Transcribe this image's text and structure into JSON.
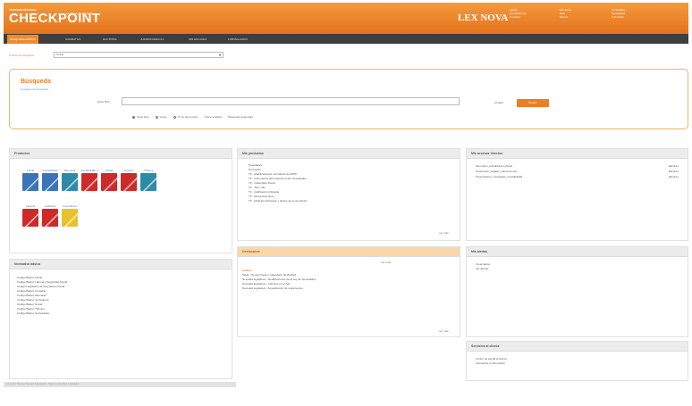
{
  "header": {
    "brand_small": "THOMSON REUTERS",
    "brand": "CHECKPOINT",
    "brand_sub": "Lex Nova Atualizações",
    "lexnova": "LEX NOVA",
    "links_col1": [
      "Ayuda",
      "Herramientas",
      "Contacto"
    ],
    "links_col2": [
      "Mis datos",
      "Salir",
      "Idioma"
    ],
    "links_col3": [
      "Comunidad",
      "Novedades",
      "Formación"
    ]
  },
  "nav": {
    "tabs": [
      "BÚSQUEDA RÁPIDA",
      "NORMATIVA",
      "DOCTRINA",
      "JURISPRUDENCIA",
      "MIS ENLACES",
      "FORMULARIOS"
    ]
  },
  "scope": {
    "label": "Ámbito de búsqueda:",
    "value": "Todos",
    "arrow": "▼"
  },
  "search": {
    "title": "Búsqueda",
    "subtitle": "Consejos de búsqueda",
    "label": "Texto libre",
    "clear": "Limpiar",
    "button": "Buscar",
    "options": [
      "Texto libre",
      "Voces",
      "Nº de documento",
      "Índice analítico",
      "Búsqueda avanzada"
    ]
  },
  "productos": {
    "title": "Productos",
    "row1": [
      {
        "label": "Fiscal",
        "color": "#3a74b8"
      },
      {
        "label": "Contabilidad",
        "color": "#3a74b8"
      },
      {
        "label": "Mercantil",
        "color": "#2e8aa8"
      },
      {
        "label": "Contabilidad II",
        "color": "#cf2a2a"
      },
      {
        "label": "Social",
        "color": "#cf2a2a"
      },
      {
        "label": "Seguros",
        "color": "#cf2a2a"
      },
      {
        "label": "Tributos",
        "color": "#2e8aa8"
      }
    ],
    "row2": [
      {
        "label": "Laboral",
        "color": "#cf2a2a"
      },
      {
        "label": "Auditoría",
        "color": "#cf2a2a"
      },
      {
        "label": "Formularios",
        "color": "#e8c22a"
      }
    ]
  },
  "novedades": {
    "title": "Mis productos",
    "items": [
      "Novedades",
      "Normativa",
      "TF - Modificaciones normativas del IRPF",
      "TF - Información del impuesto sobre Sociedades",
      "TF - Calendario Fiscal",
      "TF - Tipo más",
      "TF - Calificación tributaria",
      "TF - Resolución tipos",
      "TF - Modelos tributarios y plazos de presentación"
    ],
    "more": "ver más"
  },
  "accesos": {
    "title": "Mis accesos directos",
    "items": [
      {
        "label": "Seminario_actualizacion_fiscal",
        "action": "Eliminar"
      },
      {
        "label": "Producción_análisis_subvenciones",
        "action": "Eliminar"
      },
      {
        "label": "Presentación_novedades_Contabilidad",
        "action": "Eliminar"
      }
    ]
  },
  "destacados": {
    "title": "Destacados",
    "top_link": "Ver todo",
    "intro": "Análisis",
    "items": [
      "Tabla - Tiempo fiscal y Calendario 2015-2016",
      "Novedad legislativa - Modificaciones de la Ley de Sociedades",
      "Novedad legislativa - Cambios en el IVA",
      "Novedad legislativa - Actualización de reglamentos"
    ],
    "more": "ver más"
  },
  "misaltas": {
    "title": "Mis alertas",
    "items": [
      "Crear alerta",
      "Ver alertas"
    ]
  },
  "normativa": {
    "title": "Normativa básica",
    "items": [
      "Código Básico Fiscal",
      "Código Básico Laboral y Seguridad Social",
      "Código Legislativo de Regulación Fiscal",
      "Código Básico Contable",
      "Código Básico Mercantil",
      "Código Básico de Seguros",
      "Código Básico Social",
      "Código Básico Tributos",
      "Código Básico Sociedades"
    ]
  },
  "servicios": {
    "title": "Servicios al cliente",
    "items": [
      "Centro de ayuda al cliente",
      "Formación e información"
    ]
  },
  "footer": {
    "text": "Copyright Thomson Reuters Checkpoint · Todos los derechos reservados"
  }
}
